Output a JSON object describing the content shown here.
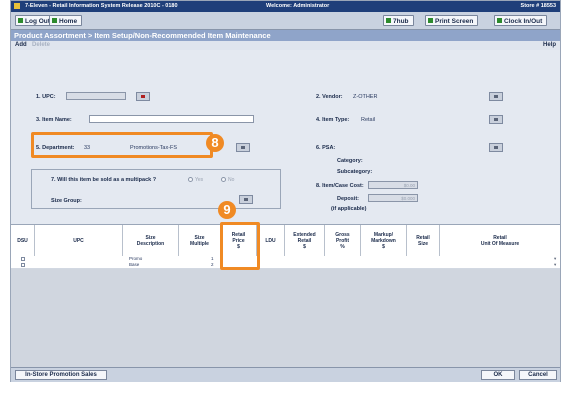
{
  "titlebar": {
    "app_title": "7-Eleven - Retail Information System  Release 2010C - 0180",
    "welcome": "Welcome: Administrator",
    "store": "Store # 18553"
  },
  "toolbar": {
    "logout": "Log Out",
    "home": "Home",
    "hub": "7hub",
    "print": "Print Screen",
    "clock": "Clock In/Out"
  },
  "breadcrumb": "Product Assortment > Item Setup/Non-Recommended Item Maintenance",
  "menu": {
    "add": "Add",
    "delete": "Delete",
    "help": "Help"
  },
  "form": {
    "upc_label": "1. UPC:",
    "vendor_label": "2. Vendor:",
    "vendor_value": "Z-OTHER",
    "item_name_label": "3. Item Name:",
    "item_type_label": "4. Item Type:",
    "item_type_value": "Retail",
    "department_label": "5. Department:",
    "department_code": "33",
    "department_name": "Promotions-Tax-FS",
    "psa_label": "6. PSA:",
    "category_label": "Category:",
    "subcategory_label": "Subcategory:",
    "multipack_label": "7. Will this item be sold as a multipack ?",
    "radio_yes": "Yes",
    "radio_no": "No",
    "size_group_label": "Size Group:",
    "case_cost_label": "8. Item/Case Cost:",
    "case_cost_placeholder": "$0.00",
    "deposit_label": "Deposit:",
    "deposit_sub": "(if applicable)",
    "deposit_placeholder": "$0.000"
  },
  "callouts": {
    "eight": "8",
    "nine": "9"
  },
  "grid": {
    "headers": [
      "DSU",
      "UPC",
      "Size\nDescription",
      "Size\nMultiple",
      "Retail\nPrice\n$",
      "LDU",
      "Extended\nRetail\n$",
      "Gross\nProfit\n%",
      "Markup/\nMarkdown\n$",
      "Retail\nSize",
      "Retail\nUnit Of Measure"
    ],
    "rows": [
      {
        "size_description": "Promo",
        "size_multiple": "1"
      },
      {
        "size_description": "Base",
        "size_multiple": "2"
      }
    ]
  },
  "footer": {
    "promo_sales": "In-Store Promotion Sales",
    "ok": "OK",
    "cancel": "Cancel"
  },
  "colors": {
    "titlebar": "#1f3f7a",
    "breadcrumb_bar": "#8fa4c9",
    "highlight": "#f08a24",
    "form_bg": "#e4e9f1"
  }
}
